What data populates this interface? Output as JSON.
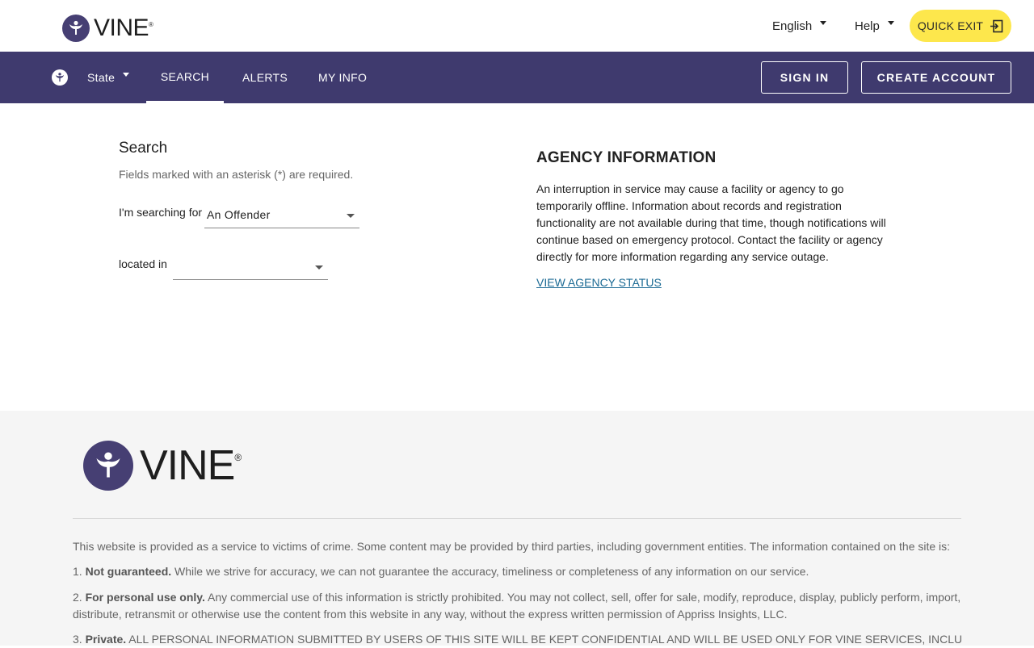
{
  "brand": {
    "name": "VINE",
    "reg": "®"
  },
  "topbar": {
    "language_label": "English",
    "help_label": "Help",
    "quick_exit_label": "QUICK EXIT"
  },
  "nav": {
    "state_label": "State",
    "items": [
      {
        "label": "SEARCH",
        "active": true
      },
      {
        "label": "ALERTS",
        "active": false
      },
      {
        "label": "MY INFO",
        "active": false
      }
    ],
    "sign_in_label": "SIGN IN",
    "create_account_label": "CREATE ACCOUNT"
  },
  "search": {
    "title": "Search",
    "required_note": "Fields marked with an asterisk (*) are required.",
    "searching_for_label": "I'm searching for",
    "searching_for_value": "An Offender",
    "located_in_label": "located in",
    "located_in_value": ""
  },
  "agency": {
    "title": "AGENCY INFORMATION",
    "body": "An interruption in service may cause a facility or agency to go temporarily offline. Information about records and registration functionality are not available during that time, though notifications will continue based on emergency protocol. Contact the facility or agency directly for more information regarding any service outage.",
    "link_label": "VIEW AGENCY STATUS"
  },
  "footer": {
    "intro": "This website is provided as a service to victims of crime. Some content may be provided by third parties, including government entities. The information contained on the site is:",
    "items": [
      {
        "num": "1.",
        "bold": "Not guaranteed.",
        "text": " While we strive for accuracy, we can not guarantee the accuracy, timeliness or completeness of any information on our service."
      },
      {
        "num": "2.",
        "bold": "For personal use only.",
        "text": " Any commercial use of this information is strictly prohibited. You may not collect, sell, offer for sale, modify, reproduce, display, publicly perform, import, distribute, retransmit or otherwise use the content from this website in any way, without the express written permission of Appriss Insights, LLC."
      },
      {
        "num": "3.",
        "bold": "Private.",
        "text": " ALL PERSONAL INFORMATION SUBMITTED BY USERS OF THIS SITE WILL BE KEPT CONFIDENTIAL AND WILL BE USED ONLY FOR VINE SERVICES, INCLUDING"
      }
    ]
  },
  "colors": {
    "nav_bg": "#3f3a6e",
    "logo_purple": "#463f73",
    "quick_exit_bg": "#fde74c",
    "link": "#1b6a94",
    "footer_bg": "#f5f5f5"
  },
  "icons": {
    "logo": "vine-figure-icon",
    "quick_exit": "exit-door-icon",
    "dropdown": "caret-down-icon"
  }
}
